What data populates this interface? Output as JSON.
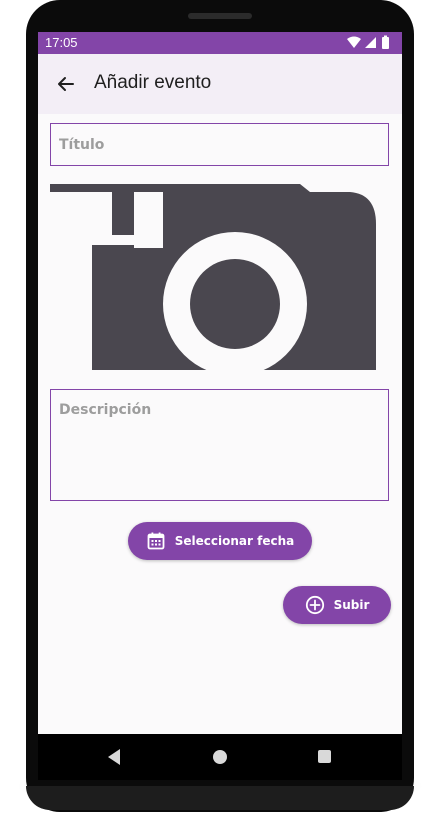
{
  "status_bar": {
    "time": "17:05",
    "icons": [
      "wifi-icon",
      "signal-icon",
      "battery-icon"
    ]
  },
  "app_bar": {
    "back_icon": "arrow-left-icon",
    "title": "Añadir evento"
  },
  "form": {
    "title_placeholder": "Título",
    "title_value": "",
    "image_icon": "camera-icon",
    "description_placeholder": "Descripción",
    "description_value": "",
    "date_button_label": "Seleccionar fecha",
    "date_button_icon": "calendar-icon",
    "submit_button_label": "Subir",
    "submit_button_icon": "plus-circle-icon"
  },
  "nav_bar": {
    "icons": [
      "nav-back-icon",
      "nav-home-icon",
      "nav-recents-icon"
    ]
  },
  "colors": {
    "primary": "#8345a8",
    "app_bar_bg": "#f3eef6",
    "screen_bg": "#fbfafb",
    "camera_fill": "#4a474f",
    "placeholder": "#9d9d9d"
  }
}
